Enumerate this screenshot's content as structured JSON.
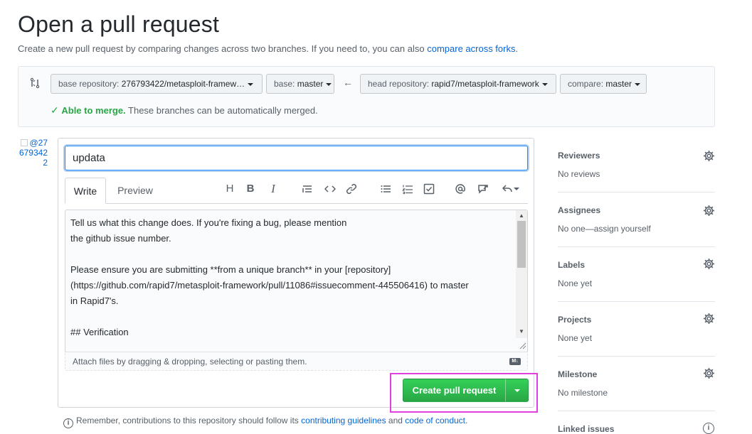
{
  "page": {
    "title": "Open a pull request",
    "subtitle_prefix": "Create a new pull request by comparing changes across two branches. If you need to, you can also ",
    "subtitle_link": "compare across forks",
    "subtitle_suffix": "."
  },
  "compare": {
    "base_repo_label": "base repository: ",
    "base_repo_value": "276793422/metasploit-framew…",
    "base_label": "base: ",
    "base_value": "master",
    "head_repo_label": "head repository: ",
    "head_repo_value": "rapid7/metasploit-framework",
    "compare_label": "compare: ",
    "compare_value": "master",
    "merge_ok": "Able to merge.",
    "merge_text": " These branches can be automatically merged."
  },
  "avatar": {
    "alt": "@276793422"
  },
  "form": {
    "title_value": "updata",
    "tabs": [
      "Write",
      "Preview"
    ],
    "toolbar_icons": [
      "header-icon",
      "bold-icon",
      "italic-icon",
      "quote-icon",
      "code-icon",
      "link-icon",
      "bullet-list-icon",
      "numbered-list-icon",
      "task-list-icon",
      "mention-icon",
      "reference-icon",
      "reply-icon"
    ],
    "body_text": "Tell us what this change does. If you're fixing a bug, please mention\nthe github issue number.\n\nPlease ensure you are submitting **from a unique branch** in your [repository]\n(https://github.com/rapid7/metasploit-framework/pull/11086#issuecomment-445506416) to master\nin Rapid7's.\n\n## Verification",
    "attach_text": "Attach files by dragging & dropping, selecting or pasting them.",
    "markdown_badge": "M↓",
    "submit_label": "Create pull request"
  },
  "guidelines": {
    "prefix": "Remember, contributions to this repository should follow its ",
    "link1": "contributing guidelines",
    "middle": " and ",
    "link2": "code of conduct",
    "suffix": "."
  },
  "sidebar": {
    "sections": [
      {
        "title": "Reviewers",
        "value": "No reviews"
      },
      {
        "title": "Assignees",
        "value": "No one—assign yourself"
      },
      {
        "title": "Labels",
        "value": "None yet"
      },
      {
        "title": "Projects",
        "value": "None yet"
      },
      {
        "title": "Milestone",
        "value": "No milestone"
      },
      {
        "title": "Linked issues",
        "value": ""
      }
    ]
  },
  "colors": {
    "accent": "#0366d6",
    "success": "#28a745",
    "highlight": "#e040e0"
  }
}
